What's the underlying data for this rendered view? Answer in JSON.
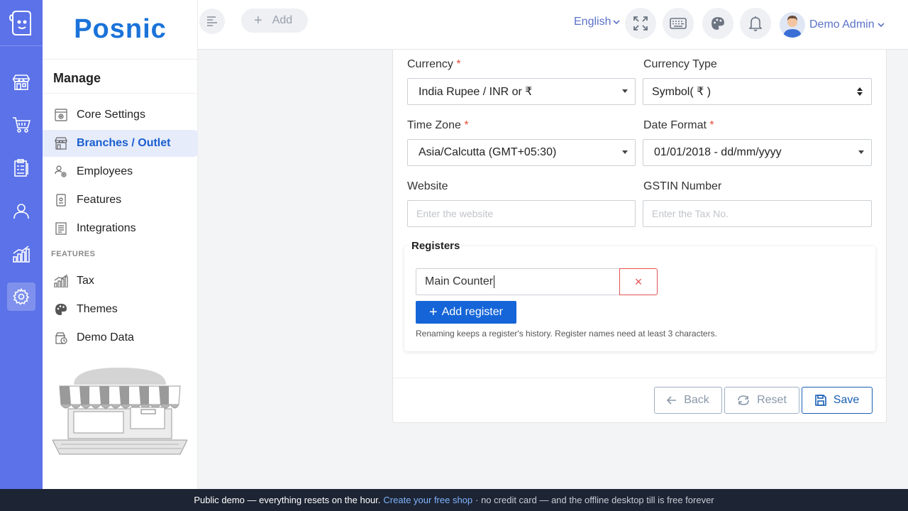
{
  "brand": {
    "name": "Posnic"
  },
  "rail": {
    "items": [
      {
        "name": "store-icon"
      },
      {
        "name": "cart-icon"
      },
      {
        "name": "clipboard-icon"
      },
      {
        "name": "user-icon"
      },
      {
        "name": "chart-icon"
      },
      {
        "name": "settings-icon",
        "active": true
      }
    ]
  },
  "menu": {
    "title": "Manage",
    "items": [
      {
        "label": "Core Settings",
        "icon": "core-settings-icon"
      },
      {
        "label": "Branches / Outlet",
        "icon": "branches-icon",
        "active": true
      },
      {
        "label": "Employees",
        "icon": "employees-icon"
      },
      {
        "label": "Features",
        "icon": "features-icon"
      },
      {
        "label": "Integrations",
        "icon": "integrations-icon"
      }
    ],
    "section_label": "FEATURES",
    "feature_items": [
      {
        "label": "Tax",
        "icon": "tax-icon"
      },
      {
        "label": "Themes",
        "icon": "palette-icon"
      },
      {
        "label": "Demo Data",
        "icon": "demo-data-icon"
      }
    ]
  },
  "topbar": {
    "add_label": "Add",
    "language": "English",
    "user_name": "Demo Admin"
  },
  "form": {
    "currency": {
      "label": "Currency",
      "required": "*",
      "value": "India Rupee / INR or ₹"
    },
    "currency_type": {
      "label": "Currency Type",
      "value": "Symbol( ₹ )"
    },
    "time_zone": {
      "label": "Time Zone",
      "required": "*",
      "value": "Asia/Calcutta (GMT+05:30)"
    },
    "date_format": {
      "label": "Date Format",
      "required": "*",
      "value": "01/01/2018 - dd/mm/yyyy"
    },
    "website": {
      "label": "Website",
      "placeholder": "Enter the website"
    },
    "gstin": {
      "label": "GSTIN Number",
      "placeholder": "Enter the Tax No."
    }
  },
  "registers": {
    "title": "Registers",
    "items": [
      {
        "value": "Main Counter"
      }
    ],
    "remove_label": "×",
    "add_label": "Add register",
    "hint": "Renaming keeps a register's history. Register names need at least 3 characters."
  },
  "actions": {
    "back": "Back",
    "reset": "Reset",
    "save": "Save"
  },
  "banner": {
    "text_before": "Public demo — everything resets on the hour.",
    "link": "Create your free shop",
    "text_after": "· no credit card — and the offline desktop till is free forever"
  },
  "colors": {
    "rail": "#5b72e8",
    "brand": "#1a73d9",
    "primary_button": "#1565d8",
    "danger": "#e45252",
    "banner": "#1d2433"
  }
}
